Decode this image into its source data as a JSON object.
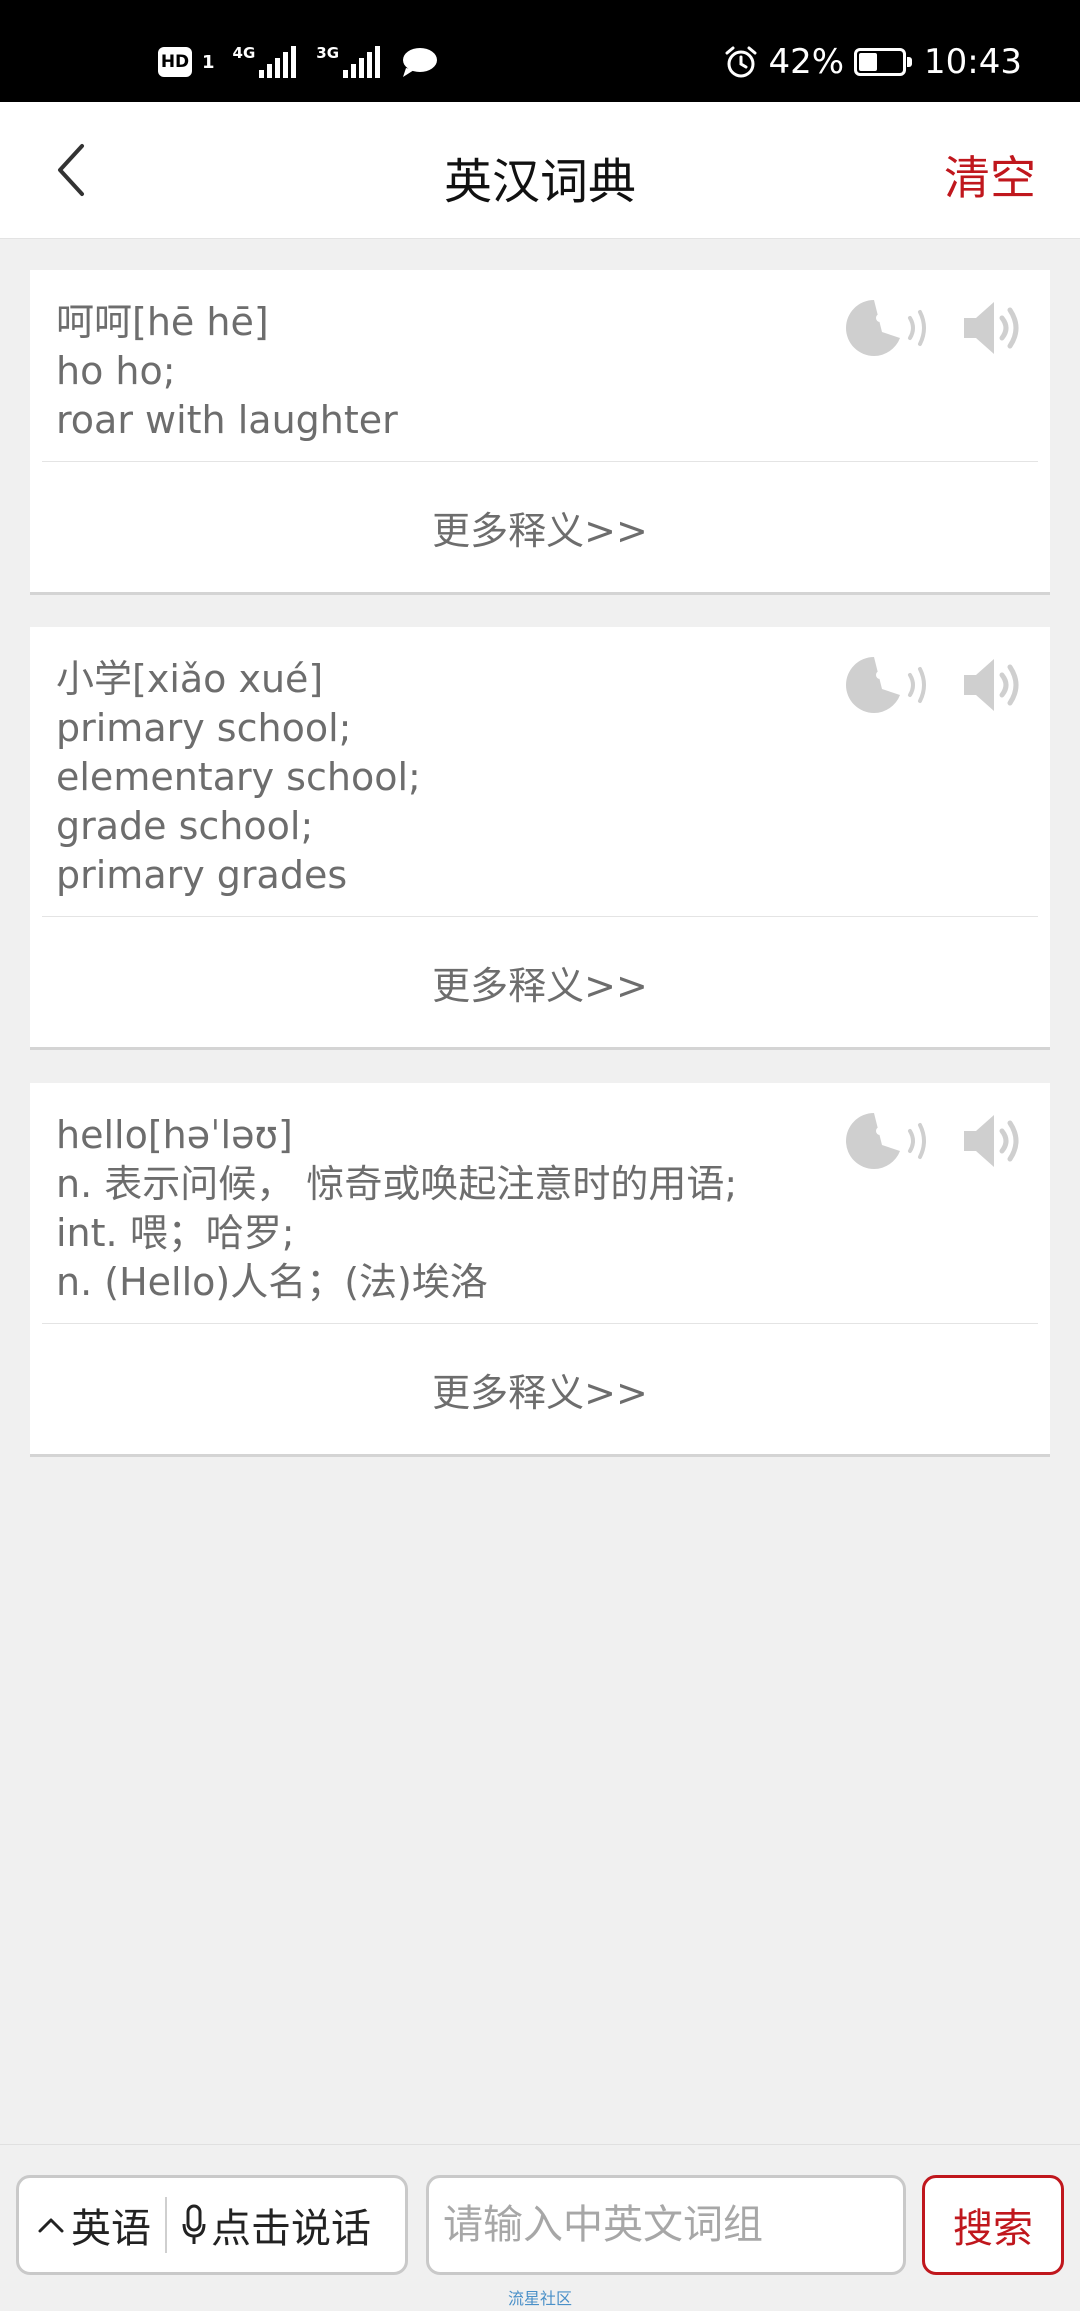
{
  "status_bar": {
    "hd_label": "HD",
    "hd_sub": "1",
    "net1_label": "4G",
    "net2_label": "3G",
    "battery_text": "42%",
    "battery_level": 0.42,
    "time": "10:43"
  },
  "header": {
    "title": "英汉词典",
    "clear_label": "清空",
    "back_icon": "chevron-left-icon"
  },
  "colors": {
    "accent": "#c0171d",
    "text_gray": "#6d6d6d",
    "background": "#f0f0f0"
  },
  "cards": [
    {
      "lines": [
        "呵呵[hē hē]",
        "ho ho;",
        "roar with laughter"
      ],
      "more_label": "更多释义>>",
      "icons": [
        "face-speak-icon",
        "speaker-icon"
      ]
    },
    {
      "lines": [
        "小学[xiǎo xué]",
        "primary school;",
        "elementary school;",
        "grade school;",
        "primary grades"
      ],
      "more_label": "更多释义>>",
      "icons": [
        "face-speak-icon",
        "speaker-icon"
      ]
    },
    {
      "lines": [
        "hello[həˈləʊ]",
        "n. 表示问候， 惊奇或唤起注意时的用语;",
        "int. 喂；哈罗;",
        "n. (Hello)人名；(法)埃洛"
      ],
      "more_label": "更多释义>>",
      "icons": [
        "face-speak-icon",
        "speaker-icon"
      ]
    }
  ],
  "bottom_bar": {
    "lang_label": "英语",
    "voice_label": "点击说话",
    "search_placeholder": "请输入中英文词组",
    "search_value": "",
    "search_button": "搜索",
    "watermark": "流星社区"
  }
}
